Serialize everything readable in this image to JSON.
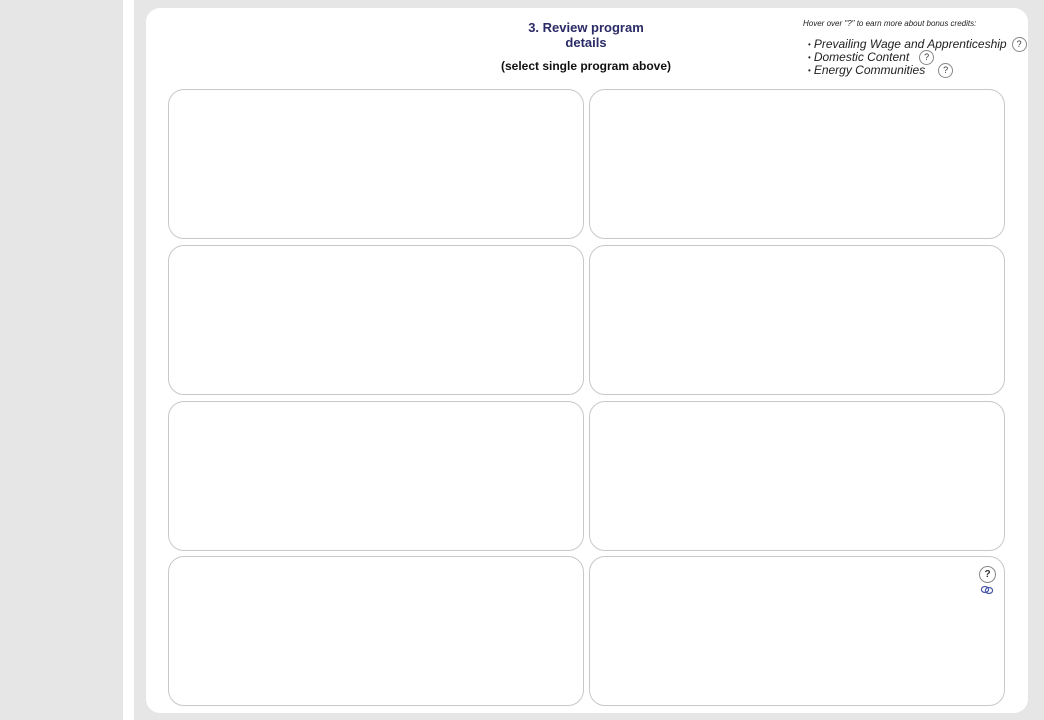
{
  "review": {
    "title": "3. Review program details",
    "subtitle": "(select single program above)"
  },
  "bonus": {
    "hover_note": "Hover over \"?\" to earn more about bonus credits:",
    "bullet": "•",
    "help_glyph": "?",
    "items": [
      {
        "label": "Prevailing Wage and Apprenticeship"
      },
      {
        "label": "Domestic Content"
      },
      {
        "label": "Energy Communities"
      }
    ]
  },
  "card_help_glyph": "?",
  "colors": {
    "title": "#2a2a66",
    "link": "#4a5aa8"
  },
  "icons": {
    "help": "question-circle-icon",
    "link": "link-icon"
  }
}
